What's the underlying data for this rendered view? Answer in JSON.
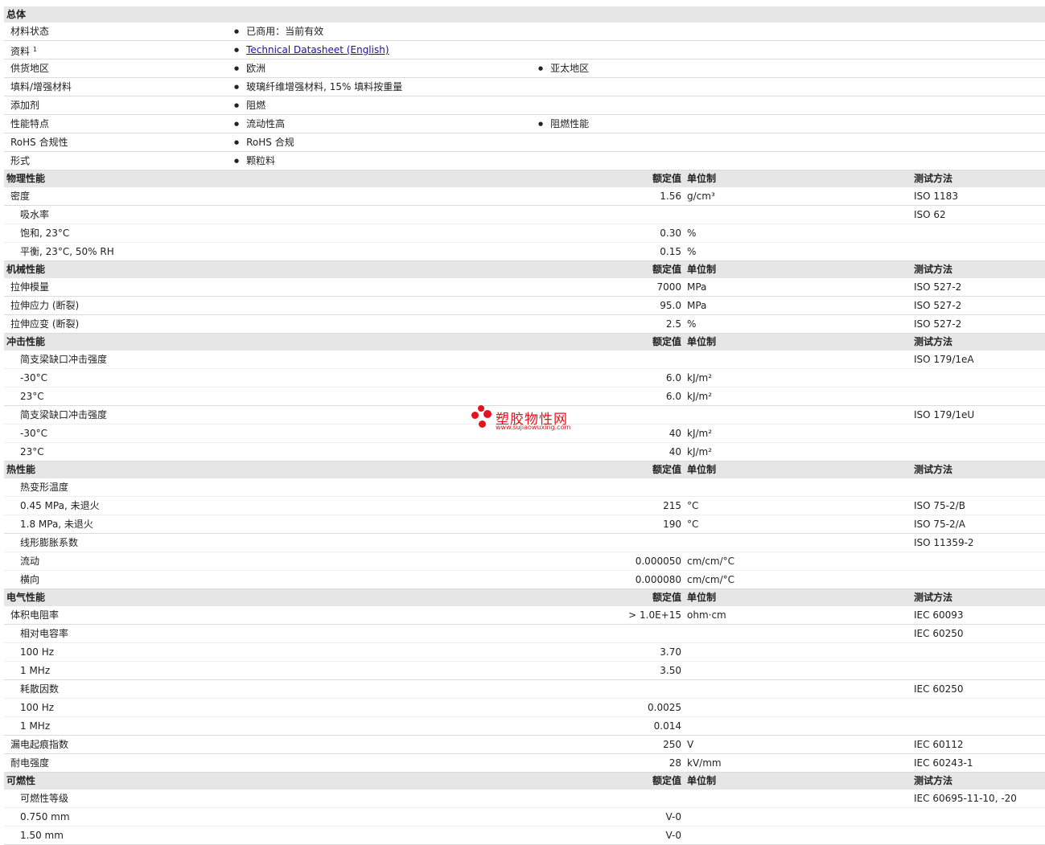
{
  "general": {
    "title": "总体",
    "rows": [
      {
        "name": "材料状态",
        "b1": "已商用：当前有效",
        "b2": ""
      },
      {
        "name": "资料",
        "sup": "1",
        "b1": "Technical Datasheet (English)",
        "b2": "",
        "link": true
      },
      {
        "name": "供货地区",
        "b1": "欧洲",
        "b2": "亚太地区"
      },
      {
        "name": "填料/增强材料",
        "b1": "玻璃纤维增强材料, 15% 填料按重量",
        "b2": ""
      },
      {
        "name": "添加剂",
        "b1": "阻燃",
        "b2": ""
      },
      {
        "name": "性能特点",
        "b1": "流动性高",
        "b2": "阻燃性能"
      },
      {
        "name": "RoHS 合规性",
        "b1": "RoHS 合规",
        "b2": ""
      },
      {
        "name": "形式",
        "b1": "颗粒料",
        "b2": ""
      }
    ]
  },
  "headers": {
    "value": "额定值",
    "unit": "单位制",
    "method": "测试方法"
  },
  "sections": [
    {
      "title": "物理性能",
      "rows": [
        {
          "name": "密度",
          "value": "1.56",
          "unit": "g/cm³",
          "method": "ISO 1183",
          "sub": false
        },
        {
          "name": "吸水率",
          "value": "",
          "unit": "",
          "method": "ISO 62",
          "sub": false
        },
        {
          "name": "饱和, 23°C",
          "value": "0.30",
          "unit": "%",
          "method": "",
          "sub": true
        },
        {
          "name": "平衡, 23°C, 50% RH",
          "value": "0.15",
          "unit": "%",
          "method": "",
          "sub": true
        }
      ]
    },
    {
      "title": "机械性能",
      "rows": [
        {
          "name": "拉伸模量",
          "value": "7000",
          "unit": "MPa",
          "method": "ISO 527-2",
          "sub": false
        },
        {
          "name": "拉伸应力 (断裂)",
          "value": "95.0",
          "unit": "MPa",
          "method": "ISO 527-2",
          "sub": false
        },
        {
          "name": "拉伸应变 (断裂)",
          "value": "2.5",
          "unit": "%",
          "method": "ISO 527-2",
          "sub": false
        }
      ]
    },
    {
      "title": "冲击性能",
      "rows": [
        {
          "name": "简支梁缺口冲击强度",
          "value": "",
          "unit": "",
          "method": "ISO 179/1eA",
          "sub": false
        },
        {
          "name": "-30°C",
          "value": "6.0",
          "unit": "kJ/m²",
          "method": "",
          "sub": true
        },
        {
          "name": "23°C",
          "value": "6.0",
          "unit": "kJ/m²",
          "method": "",
          "sub": true
        },
        {
          "name": "简支梁缺口冲击强度",
          "value": "",
          "unit": "",
          "method": "ISO 179/1eU",
          "sub": false
        },
        {
          "name": "-30°C",
          "value": "40",
          "unit": "kJ/m²",
          "method": "",
          "sub": true
        },
        {
          "name": "23°C",
          "value": "40",
          "unit": "kJ/m²",
          "method": "",
          "sub": true
        }
      ]
    },
    {
      "title": "热性能",
      "rows": [
        {
          "name": "热变形温度",
          "value": "",
          "unit": "",
          "method": "",
          "sub": false
        },
        {
          "name": "0.45 MPa, 未退火",
          "value": "215",
          "unit": "°C",
          "method": "ISO 75-2/B",
          "sub": true
        },
        {
          "name": "1.8 MPa, 未退火",
          "value": "190",
          "unit": "°C",
          "method": "ISO 75-2/A",
          "sub": true
        },
        {
          "name": "线形膨胀系数",
          "value": "",
          "unit": "",
          "method": "ISO 11359-2",
          "sub": false
        },
        {
          "name": "流动",
          "value": "0.000050",
          "unit": "cm/cm/°C",
          "method": "",
          "sub": true
        },
        {
          "name": "横向",
          "value": "0.000080",
          "unit": "cm/cm/°C",
          "method": "",
          "sub": true
        }
      ]
    },
    {
      "title": "电气性能",
      "rows": [
        {
          "name": "体积电阻率",
          "value": "> 1.0E+15",
          "unit": "ohm·cm",
          "method": "IEC 60093",
          "sub": false
        },
        {
          "name": "相对电容率",
          "value": "",
          "unit": "",
          "method": "IEC 60250",
          "sub": false
        },
        {
          "name": "100 Hz",
          "value": "3.70",
          "unit": "",
          "method": "",
          "sub": true
        },
        {
          "name": "1 MHz",
          "value": "3.50",
          "unit": "",
          "method": "",
          "sub": true
        },
        {
          "name": "耗散因数",
          "value": "",
          "unit": "",
          "method": "IEC 60250",
          "sub": false
        },
        {
          "name": "100 Hz",
          "value": "0.0025",
          "unit": "",
          "method": "",
          "sub": true
        },
        {
          "name": "1 MHz",
          "value": "0.014",
          "unit": "",
          "method": "",
          "sub": true
        },
        {
          "name": "漏电起痕指数",
          "value": "250",
          "unit": "V",
          "method": "IEC 60112",
          "sub": false
        },
        {
          "name": "耐电强度",
          "value": "28",
          "unit": "kV/mm",
          "method": "IEC 60243-1",
          "sub": false
        }
      ]
    },
    {
      "title": "可燃性",
      "rows": [
        {
          "name": "可燃性等级",
          "value": "",
          "unit": "",
          "method": "IEC 60695-11-10, -20",
          "sub": false
        },
        {
          "name": "0.750 mm",
          "value": "V-0",
          "unit": "",
          "method": "",
          "sub": true
        },
        {
          "name": "1.50 mm",
          "value": "V-0",
          "unit": "",
          "method": "",
          "sub": true
        }
      ]
    }
  ],
  "watermark": {
    "name": "塑胶物性网",
    "url": "www.sujiaowuxing.com"
  }
}
